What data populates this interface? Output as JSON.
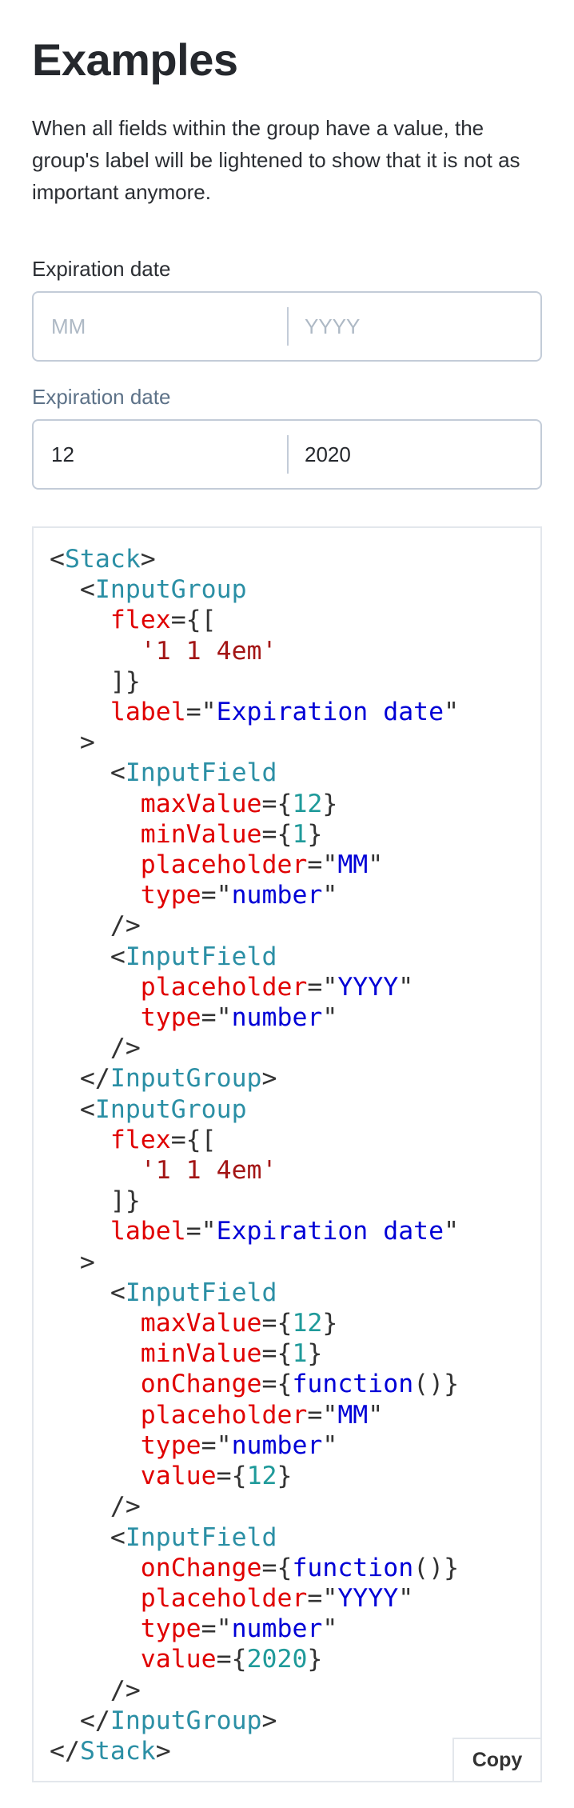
{
  "page": {
    "title": "Examples",
    "intro": "When all fields within the group have a value, the group's label will be lightened to show that it is not as important anymore."
  },
  "groups": [
    {
      "label": "Expiration date",
      "label_state": "strong",
      "fields": [
        {
          "placeholder": "MM",
          "value": ""
        },
        {
          "placeholder": "YYYY",
          "value": ""
        }
      ]
    },
    {
      "label": "Expiration date",
      "label_state": "muted",
      "fields": [
        {
          "placeholder": "MM",
          "value": "12"
        },
        {
          "placeholder": "YYYY",
          "value": "2020"
        }
      ]
    }
  ],
  "code": {
    "lines": [
      [
        [
          "pun",
          "<"
        ],
        [
          "tag",
          "Stack"
        ],
        [
          "pun",
          ">"
        ]
      ],
      [
        [
          "pun",
          "  <"
        ],
        [
          "tag",
          "InputGroup"
        ]
      ],
      [
        [
          "attr",
          "    flex"
        ],
        [
          "pun",
          "={["
        ]
      ],
      [
        [
          "lit",
          "      '1 1 4em'"
        ]
      ],
      [
        [
          "pun",
          "    ]}"
        ]
      ],
      [
        [
          "attr",
          "    label"
        ],
        [
          "pun",
          "=\""
        ],
        [
          "str",
          "Expiration date"
        ],
        [
          "pun",
          "\""
        ]
      ],
      [
        [
          "pun",
          "  >"
        ]
      ],
      [
        [
          "pun",
          "    <"
        ],
        [
          "tag",
          "InputField"
        ]
      ],
      [
        [
          "attr",
          "      maxValue"
        ],
        [
          "pun",
          "={"
        ],
        [
          "num",
          "12"
        ],
        [
          "pun",
          "}"
        ]
      ],
      [
        [
          "attr",
          "      minValue"
        ],
        [
          "pun",
          "={"
        ],
        [
          "num",
          "1"
        ],
        [
          "pun",
          "}"
        ]
      ],
      [
        [
          "attr",
          "      placeholder"
        ],
        [
          "pun",
          "=\""
        ],
        [
          "str",
          "MM"
        ],
        [
          "pun",
          "\""
        ]
      ],
      [
        [
          "attr",
          "      type"
        ],
        [
          "pun",
          "=\""
        ],
        [
          "str",
          "number"
        ],
        [
          "pun",
          "\""
        ]
      ],
      [
        [
          "pun",
          "    />"
        ]
      ],
      [
        [
          "pun",
          "    <"
        ],
        [
          "tag",
          "InputField"
        ]
      ],
      [
        [
          "attr",
          "      placeholder"
        ],
        [
          "pun",
          "=\""
        ],
        [
          "str",
          "YYYY"
        ],
        [
          "pun",
          "\""
        ]
      ],
      [
        [
          "attr",
          "      type"
        ],
        [
          "pun",
          "=\""
        ],
        [
          "str",
          "number"
        ],
        [
          "pun",
          "\""
        ]
      ],
      [
        [
          "pun",
          "    />"
        ]
      ],
      [
        [
          "pun",
          "  </"
        ],
        [
          "tag",
          "InputGroup"
        ],
        [
          "pun",
          ">"
        ]
      ],
      [
        [
          "pun",
          "  <"
        ],
        [
          "tag",
          "InputGroup"
        ]
      ],
      [
        [
          "attr",
          "    flex"
        ],
        [
          "pun",
          "={["
        ]
      ],
      [
        [
          "lit",
          "      '1 1 4em'"
        ]
      ],
      [
        [
          "pun",
          "    ]}"
        ]
      ],
      [
        [
          "attr",
          "    label"
        ],
        [
          "pun",
          "=\""
        ],
        [
          "str",
          "Expiration date"
        ],
        [
          "pun",
          "\""
        ]
      ],
      [
        [
          "pun",
          "  >"
        ]
      ],
      [
        [
          "pun",
          "    <"
        ],
        [
          "tag",
          "InputField"
        ]
      ],
      [
        [
          "attr",
          "      maxValue"
        ],
        [
          "pun",
          "={"
        ],
        [
          "num",
          "12"
        ],
        [
          "pun",
          "}"
        ]
      ],
      [
        [
          "attr",
          "      minValue"
        ],
        [
          "pun",
          "={"
        ],
        [
          "num",
          "1"
        ],
        [
          "pun",
          "}"
        ]
      ],
      [
        [
          "attr",
          "      onChange"
        ],
        [
          "pun",
          "={"
        ],
        [
          "kw",
          "function"
        ],
        [
          "pun",
          "()}"
        ]
      ],
      [
        [
          "attr",
          "      placeholder"
        ],
        [
          "pun",
          "=\""
        ],
        [
          "str",
          "MM"
        ],
        [
          "pun",
          "\""
        ]
      ],
      [
        [
          "attr",
          "      type"
        ],
        [
          "pun",
          "=\""
        ],
        [
          "str",
          "number"
        ],
        [
          "pun",
          "\""
        ]
      ],
      [
        [
          "attr",
          "      value"
        ],
        [
          "pun",
          "={"
        ],
        [
          "num",
          "12"
        ],
        [
          "pun",
          "}"
        ]
      ],
      [
        [
          "pun",
          "    />"
        ]
      ],
      [
        [
          "pun",
          "    <"
        ],
        [
          "tag",
          "InputField"
        ]
      ],
      [
        [
          "attr",
          "      onChange"
        ],
        [
          "pun",
          "={"
        ],
        [
          "kw",
          "function"
        ],
        [
          "pun",
          "()}"
        ]
      ],
      [
        [
          "attr",
          "      placeholder"
        ],
        [
          "pun",
          "=\""
        ],
        [
          "str",
          "YYYY"
        ],
        [
          "pun",
          "\""
        ]
      ],
      [
        [
          "attr",
          "      type"
        ],
        [
          "pun",
          "=\""
        ],
        [
          "str",
          "number"
        ],
        [
          "pun",
          "\""
        ]
      ],
      [
        [
          "attr",
          "      value"
        ],
        [
          "pun",
          "={"
        ],
        [
          "num",
          "2020"
        ],
        [
          "pun",
          "}"
        ]
      ],
      [
        [
          "pun",
          "    />"
        ]
      ],
      [
        [
          "pun",
          "  </"
        ],
        [
          "tag",
          "InputGroup"
        ],
        [
          "pun",
          ">"
        ]
      ],
      [
        [
          "pun",
          "</"
        ],
        [
          "tag",
          "Stack"
        ],
        [
          "pun",
          ">"
        ]
      ]
    ],
    "copy_label": "Copy"
  },
  "colors": {
    "tag": "#2b8fa5",
    "attr": "#e00000",
    "string": "#0000d6",
    "number": "#1f9a9a",
    "literal": "#a31515",
    "muted_label": "#5d7288",
    "input_border": "#c3ccd8",
    "placeholder": "#aeb9c5"
  }
}
